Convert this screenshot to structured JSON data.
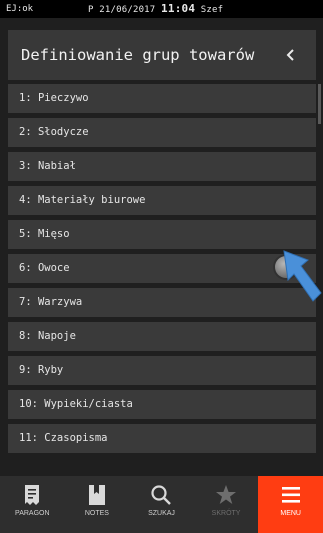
{
  "status_bar": {
    "left": "EJ:ok",
    "prefix": "P 21/06/2017",
    "time": "11:04",
    "user": "Szef"
  },
  "header": {
    "title": "Definiowanie grup towarów",
    "back_icon": "chevron-left-icon"
  },
  "list": {
    "items": [
      "1: Pieczywo",
      "2: Słodycze",
      "3: Nabiał",
      "4: Materiały biurowe",
      "5: Mięso",
      "6: Owoce",
      "7: Warzywa",
      "8: Napoje",
      "9: Ryby",
      "10: Wypieki/ciasta",
      "11: Czasopisma"
    ]
  },
  "bottom_nav": {
    "items": [
      {
        "label": "PARAGON",
        "icon": "receipt-icon"
      },
      {
        "label": "NOTES",
        "icon": "bookmark-icon"
      },
      {
        "label": "SZUKAJ",
        "icon": "search-icon"
      },
      {
        "label": "SKRÓTY",
        "icon": "star-icon"
      },
      {
        "label": "MENU",
        "icon": "menu-icon"
      }
    ]
  },
  "colors": {
    "accent": "#ff3d12",
    "background": "#1f1f1f",
    "list_item": "#3a3a3a",
    "header": "#383838",
    "pointer": "#4a90d9"
  }
}
